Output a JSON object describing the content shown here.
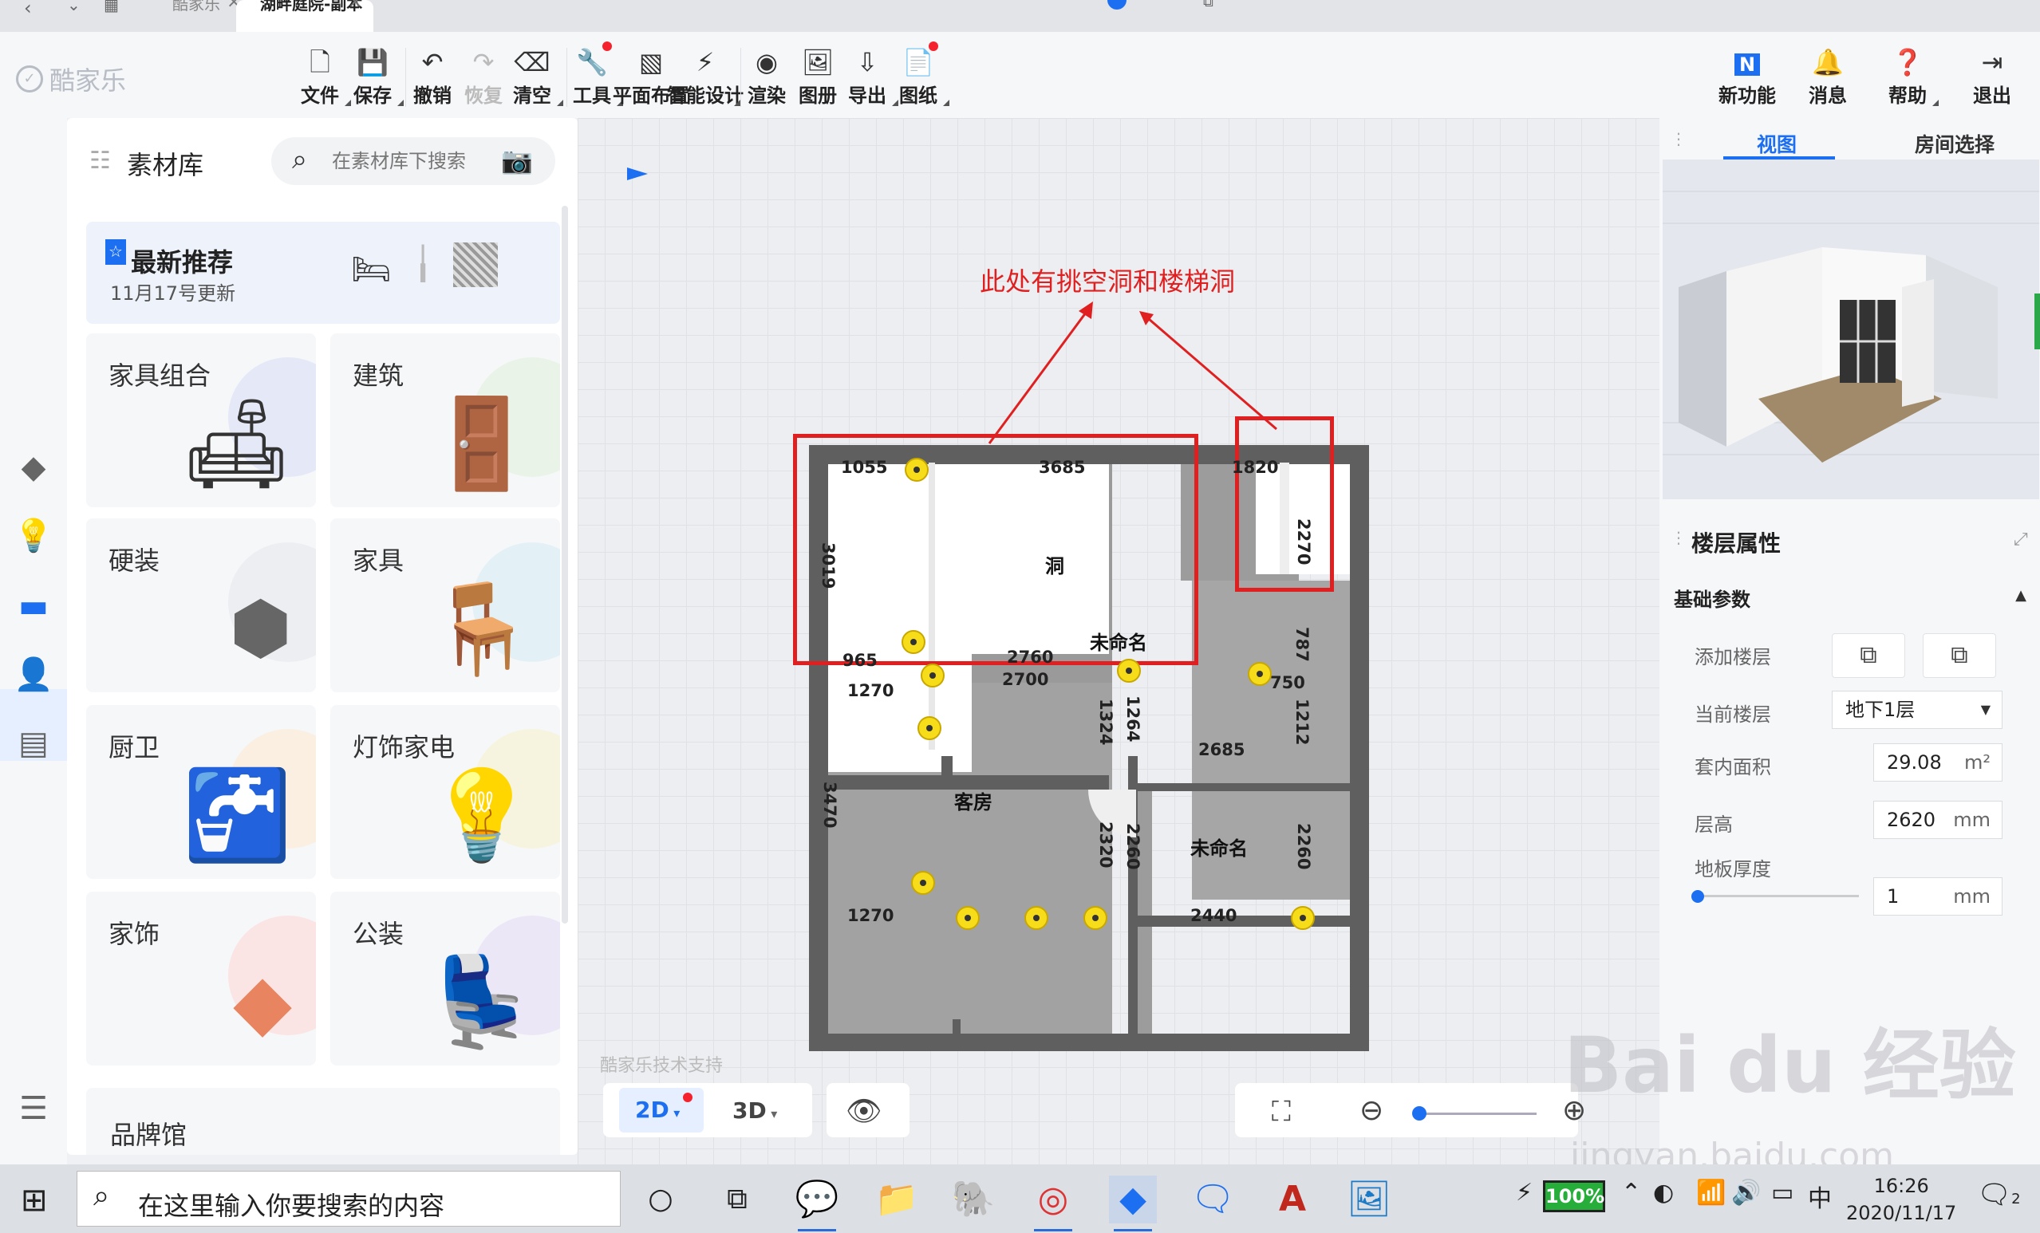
{
  "browser_tabs": [
    {
      "label": "酷家乐",
      "active": false
    },
    {
      "label": "湖畔庭院-副本",
      "active": true
    }
  ],
  "app": {
    "logo_text": "酷家乐"
  },
  "toolbar": {
    "items": [
      {
        "label": "文件",
        "icon": "file-icon"
      },
      {
        "label": "保存",
        "icon": "save-icon"
      },
      {
        "label": "撤销",
        "icon": "undo-icon"
      },
      {
        "label": "恢复",
        "icon": "redo-icon"
      },
      {
        "label": "清空",
        "icon": "eraser-icon"
      },
      {
        "label": "工具",
        "icon": "wrench-icon"
      },
      {
        "label": "平面布置",
        "icon": "floor-layout-icon"
      },
      {
        "label": "智能设计",
        "icon": "smart-design-icon"
      },
      {
        "label": "渲染",
        "icon": "render-icon"
      },
      {
        "label": "图册",
        "icon": "album-icon"
      },
      {
        "label": "导出",
        "icon": "export-icon"
      },
      {
        "label": "图纸",
        "icon": "drawing-icon"
      }
    ],
    "right_items": [
      {
        "label": "新功能",
        "icon": "new-feature-icon"
      },
      {
        "label": "消息",
        "icon": "bell-icon"
      },
      {
        "label": "帮助",
        "icon": "help-icon"
      },
      {
        "label": "退出",
        "icon": "exit-icon"
      }
    ]
  },
  "material_panel": {
    "title": "素材库",
    "search_placeholder": "在素材库下搜索",
    "recommend": {
      "title": "最新推荐",
      "subtitle": "11月17号更新"
    },
    "categories": [
      {
        "name": "家具组合",
        "blob": "#e4e8f7"
      },
      {
        "name": "建筑",
        "blob": "#eaf3e8"
      },
      {
        "name": "硬装",
        "blob": "#eceef2"
      },
      {
        "name": "家具",
        "blob": "#e3f1f6"
      },
      {
        "name": "厨卫",
        "blob": "#fbefe2"
      },
      {
        "name": "灯饰家电",
        "blob": "#f6f4de"
      },
      {
        "name": "家饰",
        "blob": "#fbe4e4"
      },
      {
        "name": "公装",
        "blob": "#ebe7f6"
      }
    ],
    "brand": "品牌馆"
  },
  "canvas": {
    "annotation": "此处有挑空洞和楼梯洞",
    "rooms": {
      "hole": "洞",
      "unnamed_top": "未命名",
      "guest_room": "客房",
      "unnamed_bottom": "未命名"
    },
    "dims": {
      "top_left": "1055",
      "top_mid": "3685",
      "top_right": "1820",
      "left_top": "3019",
      "right_top": "2270",
      "mid_left": "965",
      "mid_mid": "2760",
      "mid_2700": "2700",
      "left_1270": "1270",
      "right_787": "787",
      "right_750": "750",
      "v_1324": "1324",
      "v_1264": "1264",
      "v_1212": "1212",
      "h_2685": "2685",
      "left_3470": "3470",
      "v_2320": "2320",
      "v_2260a": "2260",
      "v_2260b": "2260",
      "bottom_1270": "1270",
      "bottom_2440": "2440"
    },
    "credit": "酷家乐技术支持",
    "view_2d": "2D",
    "view_3d": "3D"
  },
  "right_panel": {
    "tabs": [
      {
        "label": "视图",
        "active": true
      },
      {
        "label": "房间选择",
        "active": false
      }
    ],
    "floor_props_title": "楼层属性",
    "section": "基础参数",
    "rows": {
      "add_floor": "添加楼层",
      "current_floor_label": "当前楼层",
      "current_floor_value": "地下1层",
      "area_label": "套内面积",
      "area_value": "29.08",
      "area_unit": "m²",
      "height_label": "层高",
      "height_value": "2620",
      "height_unit": "mm",
      "floor_thick_label": "地板厚度",
      "floor_thick_value": "1",
      "floor_thick_unit": "mm"
    }
  },
  "taskbar": {
    "search_text": "在这里输入你要搜索的内容",
    "battery": "100%",
    "ime": "中",
    "time": "16:26",
    "date": "2020/11/17",
    "notif_count": "2"
  },
  "watermark": {
    "main": "Bai du 经验",
    "sub": "jingyan.baidu.com"
  },
  "colors": {
    "accent": "#1d6ff2",
    "annotation": "#e02020",
    "wall": "#5f5f5f",
    "marker": "#f7dc1a"
  }
}
